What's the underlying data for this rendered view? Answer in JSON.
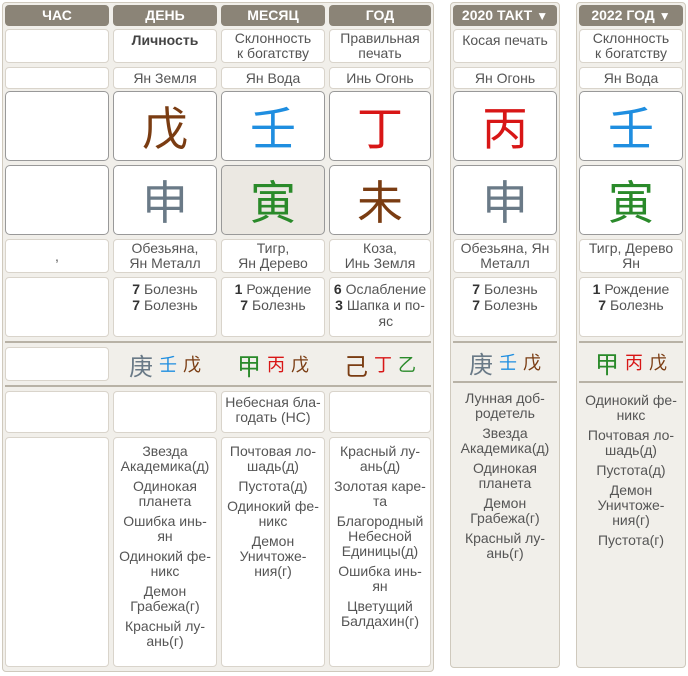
{
  "headers": {
    "hour": "ЧАС",
    "day": "ДЕНЬ",
    "month": "МЕСЯЦ",
    "year": "ГОД",
    "tact2020": "2020 ТАКТ",
    "year2022": "2022 ГОД",
    "dropdown_arrow": "▼"
  },
  "stars_row": {
    "hour": "",
    "day": "Личность",
    "month": "Склонность\nк богатству",
    "year": "Правильная\nпечать",
    "tact2020": "Косая печать",
    "year2022": "Склонность\nк богатству"
  },
  "element_row": {
    "day": "Ян Земля",
    "month": "Ян Вода",
    "year": "Инь Огонь",
    "tact2020": "Ян Огонь",
    "year2022": "Ян Вода"
  },
  "stems": {
    "day": "戊",
    "month": "壬",
    "year": "丁",
    "tact2020": "丙",
    "year2022": "壬"
  },
  "branches": {
    "day": "申",
    "month": "寅",
    "year": "未",
    "tact2020": "申",
    "year2022": "寅"
  },
  "branch_names": {
    "hour": ",",
    "day": "Обезьяна,\nЯн Металл",
    "month": "Тигр,\nЯн Дерево",
    "year": "Коза,\nИнь Земля",
    "tact2020": "Обезьяна, Ян\nМеталл",
    "year2022": "Тигр, Дерево\nЯн"
  },
  "stages": {
    "day": [
      {
        "num": "7",
        "text": "Болезнь"
      },
      {
        "num": "7",
        "text": "Болезнь"
      }
    ],
    "month": [
      {
        "num": "1",
        "text": "Рождение"
      },
      {
        "num": "7",
        "text": "Болезнь"
      }
    ],
    "year": [
      {
        "num": "6",
        "text": "Ослабление"
      },
      {
        "num": "3",
        "text": "Шапка и по-\nяс"
      }
    ],
    "tact2020": [
      {
        "num": "7",
        "text": "Болезнь"
      },
      {
        "num": "7",
        "text": "Болезнь"
      }
    ],
    "year2022": [
      {
        "num": "1",
        "text": "Рождение"
      },
      {
        "num": "7",
        "text": "Болезнь"
      }
    ]
  },
  "hidden_stems": {
    "day": [
      "庚",
      "壬",
      "戊"
    ],
    "month": [
      "甲",
      "丙",
      "戊"
    ],
    "year": [
      "己",
      "丁",
      "乙"
    ],
    "tact2020": [
      "庚",
      "壬",
      "戊"
    ],
    "year2022": [
      "甲",
      "丙",
      "戊"
    ]
  },
  "special_stars": {
    "month": "Небесная бла-\nгодать (НС)",
    "tact2020": "Лунная доб-\nродетель"
  },
  "symbolic_stars": {
    "day": [
      "Звезда\nАкадемика(д)",
      "Одинокая\nпланета",
      "Ошибка инь-\nян",
      "Одинокий фе-\nникс",
      "Демон\nГрабежа(г)",
      "Красный лу-\nань(г)"
    ],
    "month": [
      "Почтовая ло-\nшадь(д)",
      "Пустота(д)",
      "Одинокий фе-\nникс",
      "Демон\nУничтоже-\nния(г)"
    ],
    "year": [
      "Красный лу-\nань(д)",
      "Золотая каре-\nта",
      "Благородный\nНебесной\nЕдиницы(д)",
      "Ошибка инь-\nян",
      "Цветущий\nБалдахин(г)"
    ],
    "tact2020": [
      "Звезда\nАкадемика(д)",
      "Одинокая\nпланета",
      "Демон\nГрабежа(г)",
      "Красный лу-\nань(г)"
    ],
    "year2022": [
      "Одинокий фе-\nникс",
      "Почтовая ло-\nшадь(д)",
      "Пустота(д)",
      "Демон\nУничтоже-\nния(г)",
      "Пустота(г)"
    ]
  },
  "colors": {
    "header_bg": "#8b8477",
    "panel_bg": "#f1efea",
    "earth": "#7a3c12",
    "water": "#1f8ee0",
    "fire": "#d81616",
    "wood": "#2a8a2a",
    "metal": "#6a7a87"
  }
}
